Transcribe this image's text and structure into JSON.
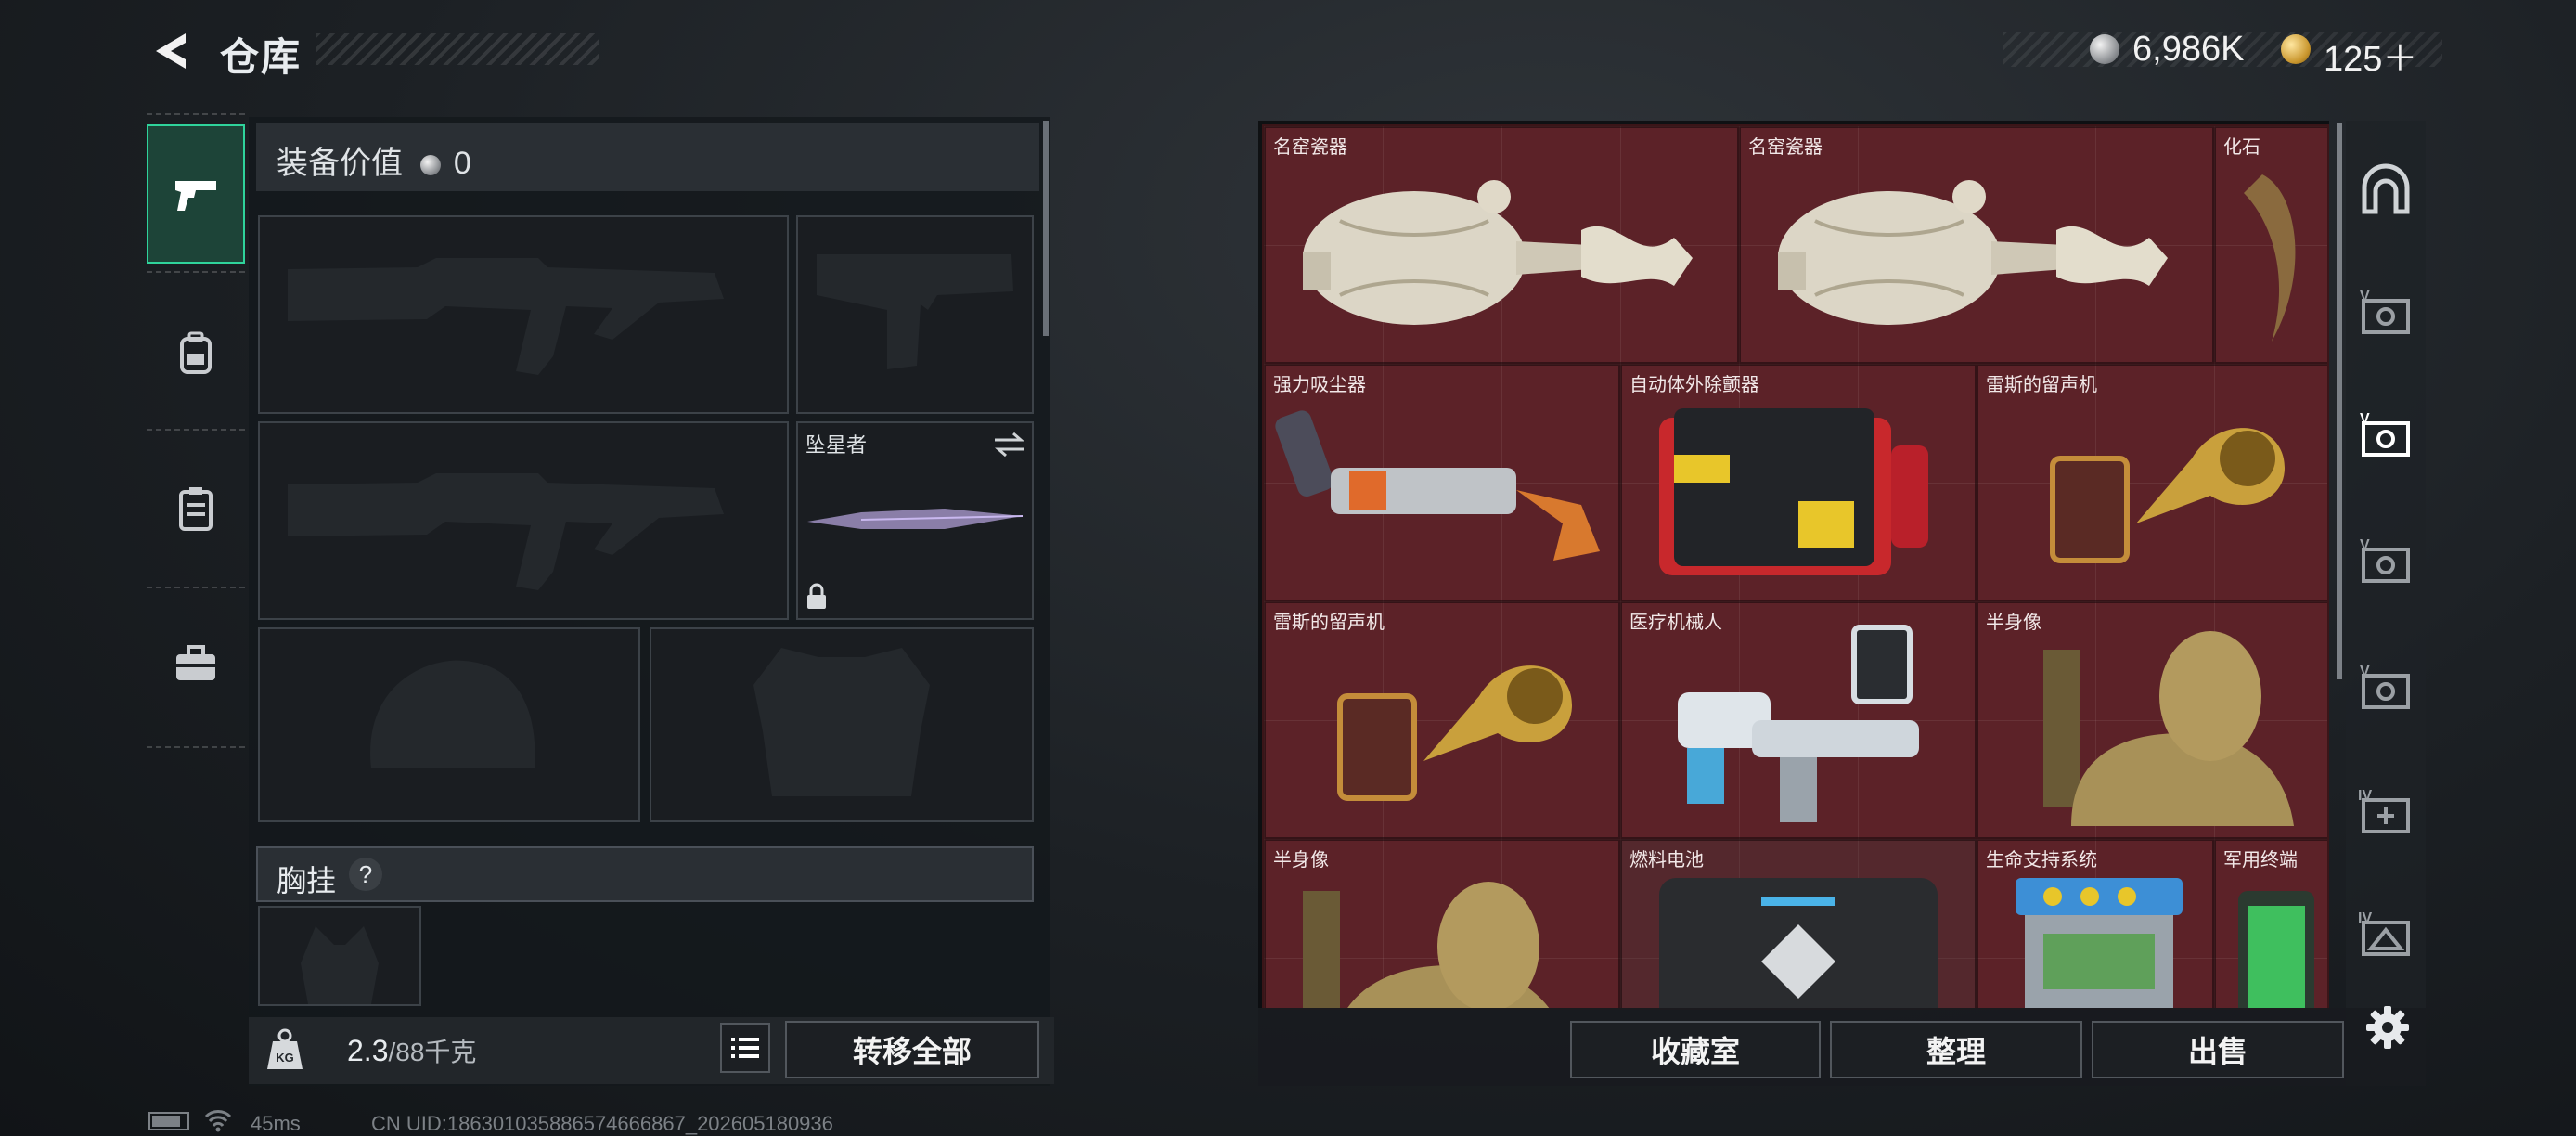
{
  "header": {
    "title": "仓库"
  },
  "currency": {
    "silver": "6,986K",
    "gold": "125＋"
  },
  "left_tabs": [
    {
      "name": "pistol-icon",
      "selected": true
    },
    {
      "name": "backpack-icon",
      "selected": false
    },
    {
      "name": "locker-icon",
      "selected": false
    },
    {
      "name": "toolbox-icon",
      "selected": false
    }
  ],
  "equipment": {
    "value_label": "装备价值",
    "value": "0",
    "melee_name": "坠星者",
    "chest_label": "胸挂",
    "chest_help": "?"
  },
  "weight": {
    "current": "2.3",
    "max": "/88千克",
    "icon_text": "KG"
  },
  "buttons": {
    "transfer_all": "转移全部",
    "collection": "收藏室",
    "organize": "整理",
    "sell": "出售"
  },
  "items": [
    {
      "name": "名窑瓷器",
      "icon": "vase-icon"
    },
    {
      "name": "名窑瓷器",
      "icon": "vase-icon"
    },
    {
      "name": "化石",
      "icon": "fossil-claw-icon"
    },
    {
      "name": "强力吸尘器",
      "icon": "vacuum-icon"
    },
    {
      "name": "自动体外除颤器",
      "icon": "defibrillator-icon"
    },
    {
      "name": "雷斯的留声机",
      "icon": "gramophone-icon"
    },
    {
      "name": "雷斯的留声机",
      "icon": "gramophone-icon"
    },
    {
      "name": "医疗机械人",
      "icon": "medical-robot-icon"
    },
    {
      "name": "半身像",
      "icon": "bust-icon"
    },
    {
      "name": "半身像",
      "icon": "bust-icon"
    },
    {
      "name": "燃料电池",
      "icon": "fuel-cell-icon"
    },
    {
      "name": "生命支持系统",
      "icon": "life-support-icon"
    },
    {
      "name": "军用终端",
      "icon": "military-terminal-icon"
    }
  ],
  "right_tabs": [
    {
      "name": "vault-icon",
      "label": ""
    },
    {
      "name": "storage-v-icon",
      "label": "V"
    },
    {
      "name": "storage-v-icon",
      "label": "V"
    },
    {
      "name": "storage-v-icon",
      "label": "V"
    },
    {
      "name": "storage-v-icon",
      "label": "V"
    },
    {
      "name": "storage-iv-add-icon",
      "label": "IV"
    },
    {
      "name": "storage-iv-icon",
      "label": "IV"
    }
  ],
  "status": {
    "ping": "45ms",
    "uid": "CN UID:186301035886574666867_202605180936"
  },
  "colors": {
    "accent": "#2fd39b",
    "grid_bg": "#5c2228",
    "panel": "#1a1d21"
  }
}
